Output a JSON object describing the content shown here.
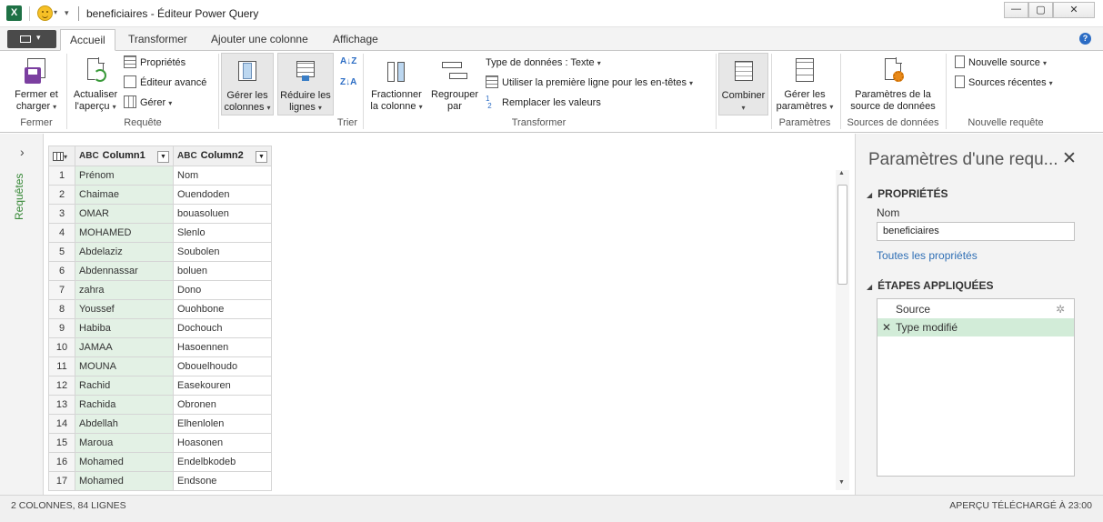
{
  "window": {
    "title": "beneficiaires - Éditeur Power Query",
    "excel_icon_label": "X",
    "minimize": "—",
    "maximize": "▢",
    "close": "✕"
  },
  "ribbon_tabs": [
    "Accueil",
    "Transformer",
    "Ajouter une colonne",
    "Affichage"
  ],
  "ribbon": {
    "fermer": {
      "btn_line1": "Fermer et",
      "btn_line2": "charger",
      "group": "Fermer"
    },
    "requete": {
      "actualiser_line1": "Actualiser",
      "actualiser_line2": "l'aperçu",
      "proprietes": "Propriétés",
      "editeur": "Éditeur avancé",
      "gerer": "Gérer",
      "group": "Requête"
    },
    "gerer_colonnes": {
      "line1": "Gérer les",
      "line2": "colonnes"
    },
    "reduire_lignes": {
      "line1": "Réduire les",
      "line2": "lignes"
    },
    "trier": {
      "group": "Trier"
    },
    "transformer": {
      "fractionner_line1": "Fractionner",
      "fractionner_line2": "la colonne",
      "regrouper_line1": "Regrouper",
      "regrouper_line2": "par",
      "type_donnees": "Type de données : Texte",
      "premiere_ligne": "Utiliser la première ligne pour les en-têtes",
      "remplacer": "Remplacer les valeurs",
      "group": "Transformer"
    },
    "combiner": {
      "label": "Combiner"
    },
    "parametres": {
      "line1": "Gérer les",
      "line2": "paramètres",
      "group": "Paramètres"
    },
    "sources": {
      "line1": "Paramètres de la",
      "line2": "source de données",
      "group": "Sources de données"
    },
    "nouvelle": {
      "nouvelle_source": "Nouvelle source",
      "sources_recentes": "Sources récentes",
      "group": "Nouvelle requête"
    }
  },
  "queries_pane": {
    "label": "Requêtes"
  },
  "grid": {
    "columns": [
      "Column1",
      "Column2"
    ],
    "rows": [
      [
        "1",
        "Prénom",
        "Nom"
      ],
      [
        "2",
        "Chaimae",
        "Ouendoden"
      ],
      [
        "3",
        "OMAR",
        "bouasoluen"
      ],
      [
        "4",
        "MOHAMED",
        "Slenlo"
      ],
      [
        "5",
        "Abdelaziz",
        "Soubolen"
      ],
      [
        "6",
        "Abdennassar",
        "boluen"
      ],
      [
        "7",
        "zahra",
        "Dono"
      ],
      [
        "8",
        "Youssef",
        "Ouohbone"
      ],
      [
        "9",
        "Habiba",
        "Dochouch"
      ],
      [
        "10",
        "JAMAA",
        "Hasoennen"
      ],
      [
        "11",
        "MOUNA",
        "Obouelhoudo"
      ],
      [
        "12",
        "Rachid",
        "Easekouren"
      ],
      [
        "13",
        "Rachida",
        "Obronen"
      ],
      [
        "14",
        "Abdellah",
        "Elhenlolen"
      ],
      [
        "15",
        "Maroua",
        "Hoasonen"
      ],
      [
        "16",
        "Mohamed",
        "Endelbkodeb"
      ],
      [
        "17",
        "Mohamed",
        "Endsone"
      ]
    ]
  },
  "settings": {
    "title": "Paramètres d'une requ...",
    "properties_header": "PROPRIÉTÉS",
    "name_label": "Nom",
    "name_value": "beneficiaires",
    "all_properties_link": "Toutes les propriétés",
    "steps_header": "ÉTAPES APPLIQUÉES",
    "steps": [
      "Source",
      "Type modifié"
    ]
  },
  "status": {
    "left": "2 COLONNES, 84 LIGNES",
    "right": "APERÇU TÉLÉCHARGÉ À 23:00"
  },
  "colors": {
    "accent_green": "#e3f1e5",
    "step_selected": "#d2ecd8",
    "link": "#2f6fb5"
  }
}
